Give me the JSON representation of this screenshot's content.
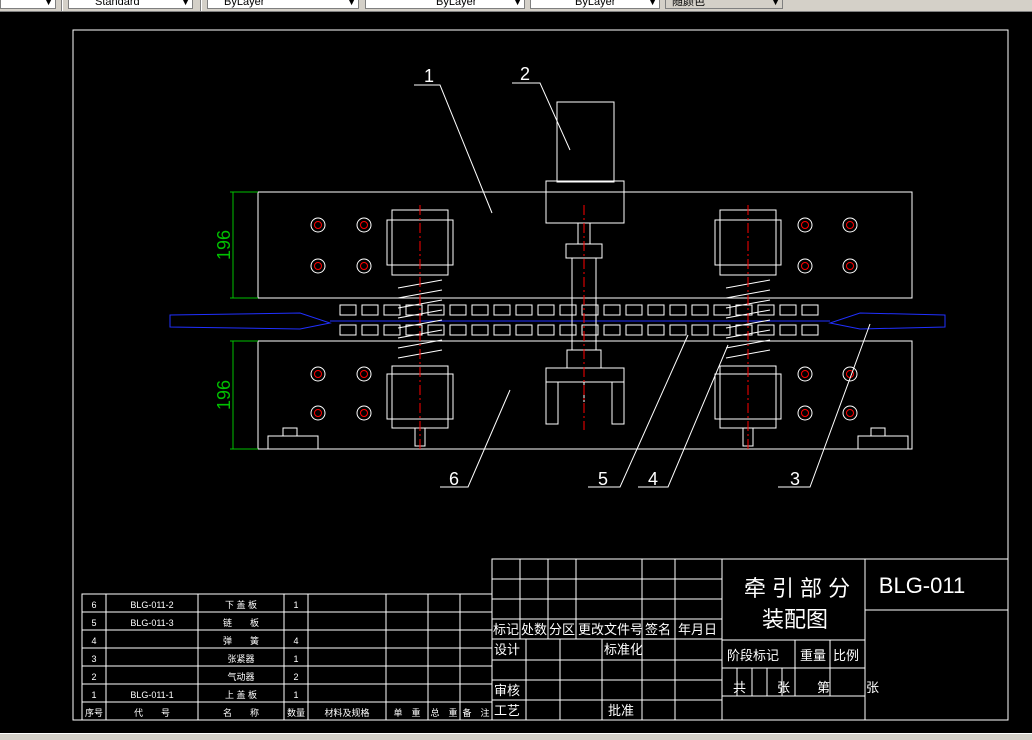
{
  "toolbar": {
    "text_style": "Standard",
    "layer": "ByLayer",
    "linetype": "ByLayer",
    "lineweight": "ByLayer",
    "color": "随颜色"
  },
  "colors": {
    "background": "#000000",
    "line": "#ffffff",
    "centerline": "#ff0000",
    "dimension": "#00c000",
    "material": "#2030ff",
    "toolbar": "#d4d0c8"
  },
  "drawing": {
    "callouts": [
      "1",
      "2",
      "3",
      "4",
      "5",
      "6"
    ],
    "dimensions": [
      "196",
      "196"
    ]
  },
  "bom": {
    "rows": [
      {
        "no": "6",
        "code": "BLG-011-2",
        "name": "下 盖 板",
        "qty": "1"
      },
      {
        "no": "5",
        "code": "BLG-011-3",
        "name": "链　　板",
        "qty": ""
      },
      {
        "no": "4",
        "code": "",
        "name": "弹　　簧",
        "qty": "4"
      },
      {
        "no": "3",
        "code": "",
        "name": "张紧器",
        "qty": "1"
      },
      {
        "no": "2",
        "code": "",
        "name": "气动器",
        "qty": "2"
      },
      {
        "no": "1",
        "code": "BLG-011-1",
        "name": "上 盖 板",
        "qty": "1"
      }
    ],
    "headers": {
      "no": "序号",
      "code": "代　　号",
      "name": "名　　称",
      "qty": "数量",
      "material": "材料及规格",
      "unit": "单　重",
      "total": "总　重",
      "note": "备　注"
    }
  },
  "titleblock": {
    "revision_headers": [
      "标记",
      "处数",
      "分区",
      "更改文件号",
      "签名",
      "年月日"
    ],
    "design": "设计",
    "standardization": "标准化",
    "review": "审核",
    "process": "工艺",
    "approve": "批准",
    "title_line1": "牵 引 部 分",
    "title_line2": "装配图",
    "stage": "阶段标记",
    "weight": "重量",
    "scale": "比例",
    "sheet_total": "共",
    "sheet_unit1": "张",
    "sheet_no": "第",
    "sheet_unit2": "张",
    "drawing_no": "BLG-011"
  }
}
